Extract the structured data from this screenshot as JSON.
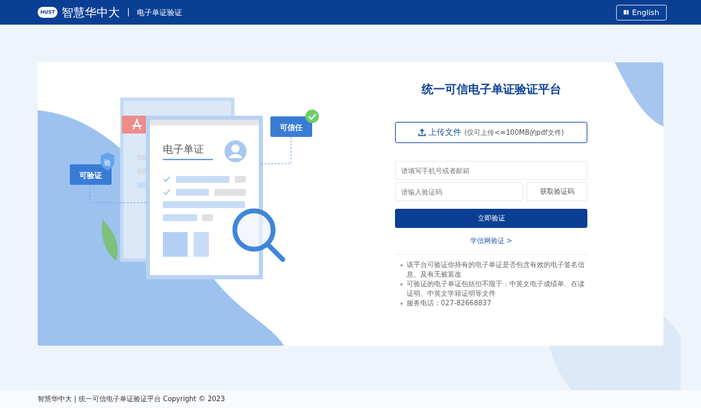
{
  "header": {
    "logo_badge": "HUST",
    "logo_text": "智慧华中大",
    "subtitle": "电子单证验证",
    "language_button": "English"
  },
  "illustration": {
    "document_title": "电子单证",
    "tag_left": "可验证",
    "tag_left_badge": "验",
    "tag_right": "可信任"
  },
  "form": {
    "title": "统一可信电子单证验证平台",
    "upload_button": "上传文件",
    "upload_hint": "(仅可上传<=100MB的pdf文件)",
    "contact_field": {
      "placeholder": "请填写手机号或者邮箱"
    },
    "code_field": {
      "placeholder": "请输入验证码"
    },
    "get_code_button": "获取验证码",
    "verify_button": "立即验证",
    "alt_link": "学信网验证 >",
    "notes": [
      "该平台可验证你持有的电子单证是否包含有效的电子签名信息、及有无被篡改",
      "可验证的电子单证包括但不限于：中英文电子成绩单、在读证明、中英文学籍证明等文件",
      "服务电话：027-82668837"
    ]
  },
  "footer": "智慧华中大 | 统一可信电子单证验证平台 Copyright © 2023"
}
